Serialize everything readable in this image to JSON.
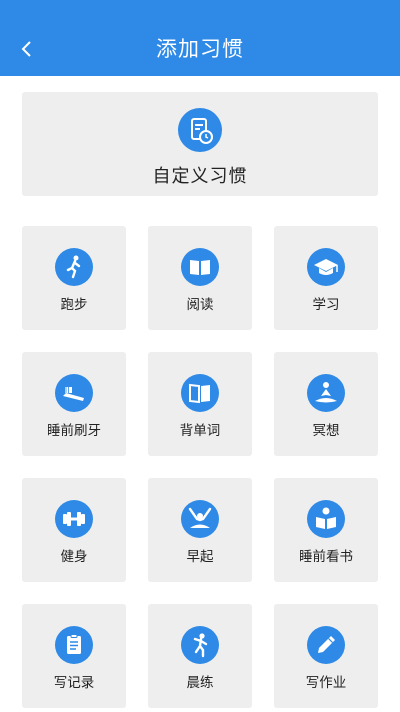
{
  "header": {
    "title": "添加习惯",
    "back_icon": "chevron-left-icon"
  },
  "custom": {
    "label": "自定义习惯",
    "icon": "document-clock-icon"
  },
  "habits": [
    {
      "label": "跑步",
      "icon": "runner-icon"
    },
    {
      "label": "阅读",
      "icon": "open-book-icon"
    },
    {
      "label": "学习",
      "icon": "graduation-cap-icon"
    },
    {
      "label": "睡前刷牙",
      "icon": "toothbrush-icon"
    },
    {
      "label": "背单词",
      "icon": "dictionary-icon"
    },
    {
      "label": "冥想",
      "icon": "meditation-icon"
    },
    {
      "label": "健身",
      "icon": "dumbbell-icon"
    },
    {
      "label": "早起",
      "icon": "wake-up-icon"
    },
    {
      "label": "睡前看书",
      "icon": "reading-person-icon"
    },
    {
      "label": "写记录",
      "icon": "clipboard-icon"
    },
    {
      "label": "晨练",
      "icon": "morning-exercise-icon"
    },
    {
      "label": "写作业",
      "icon": "pencil-icon"
    }
  ],
  "colors": {
    "accent": "#2e8ae6",
    "card": "#eeeeee"
  }
}
